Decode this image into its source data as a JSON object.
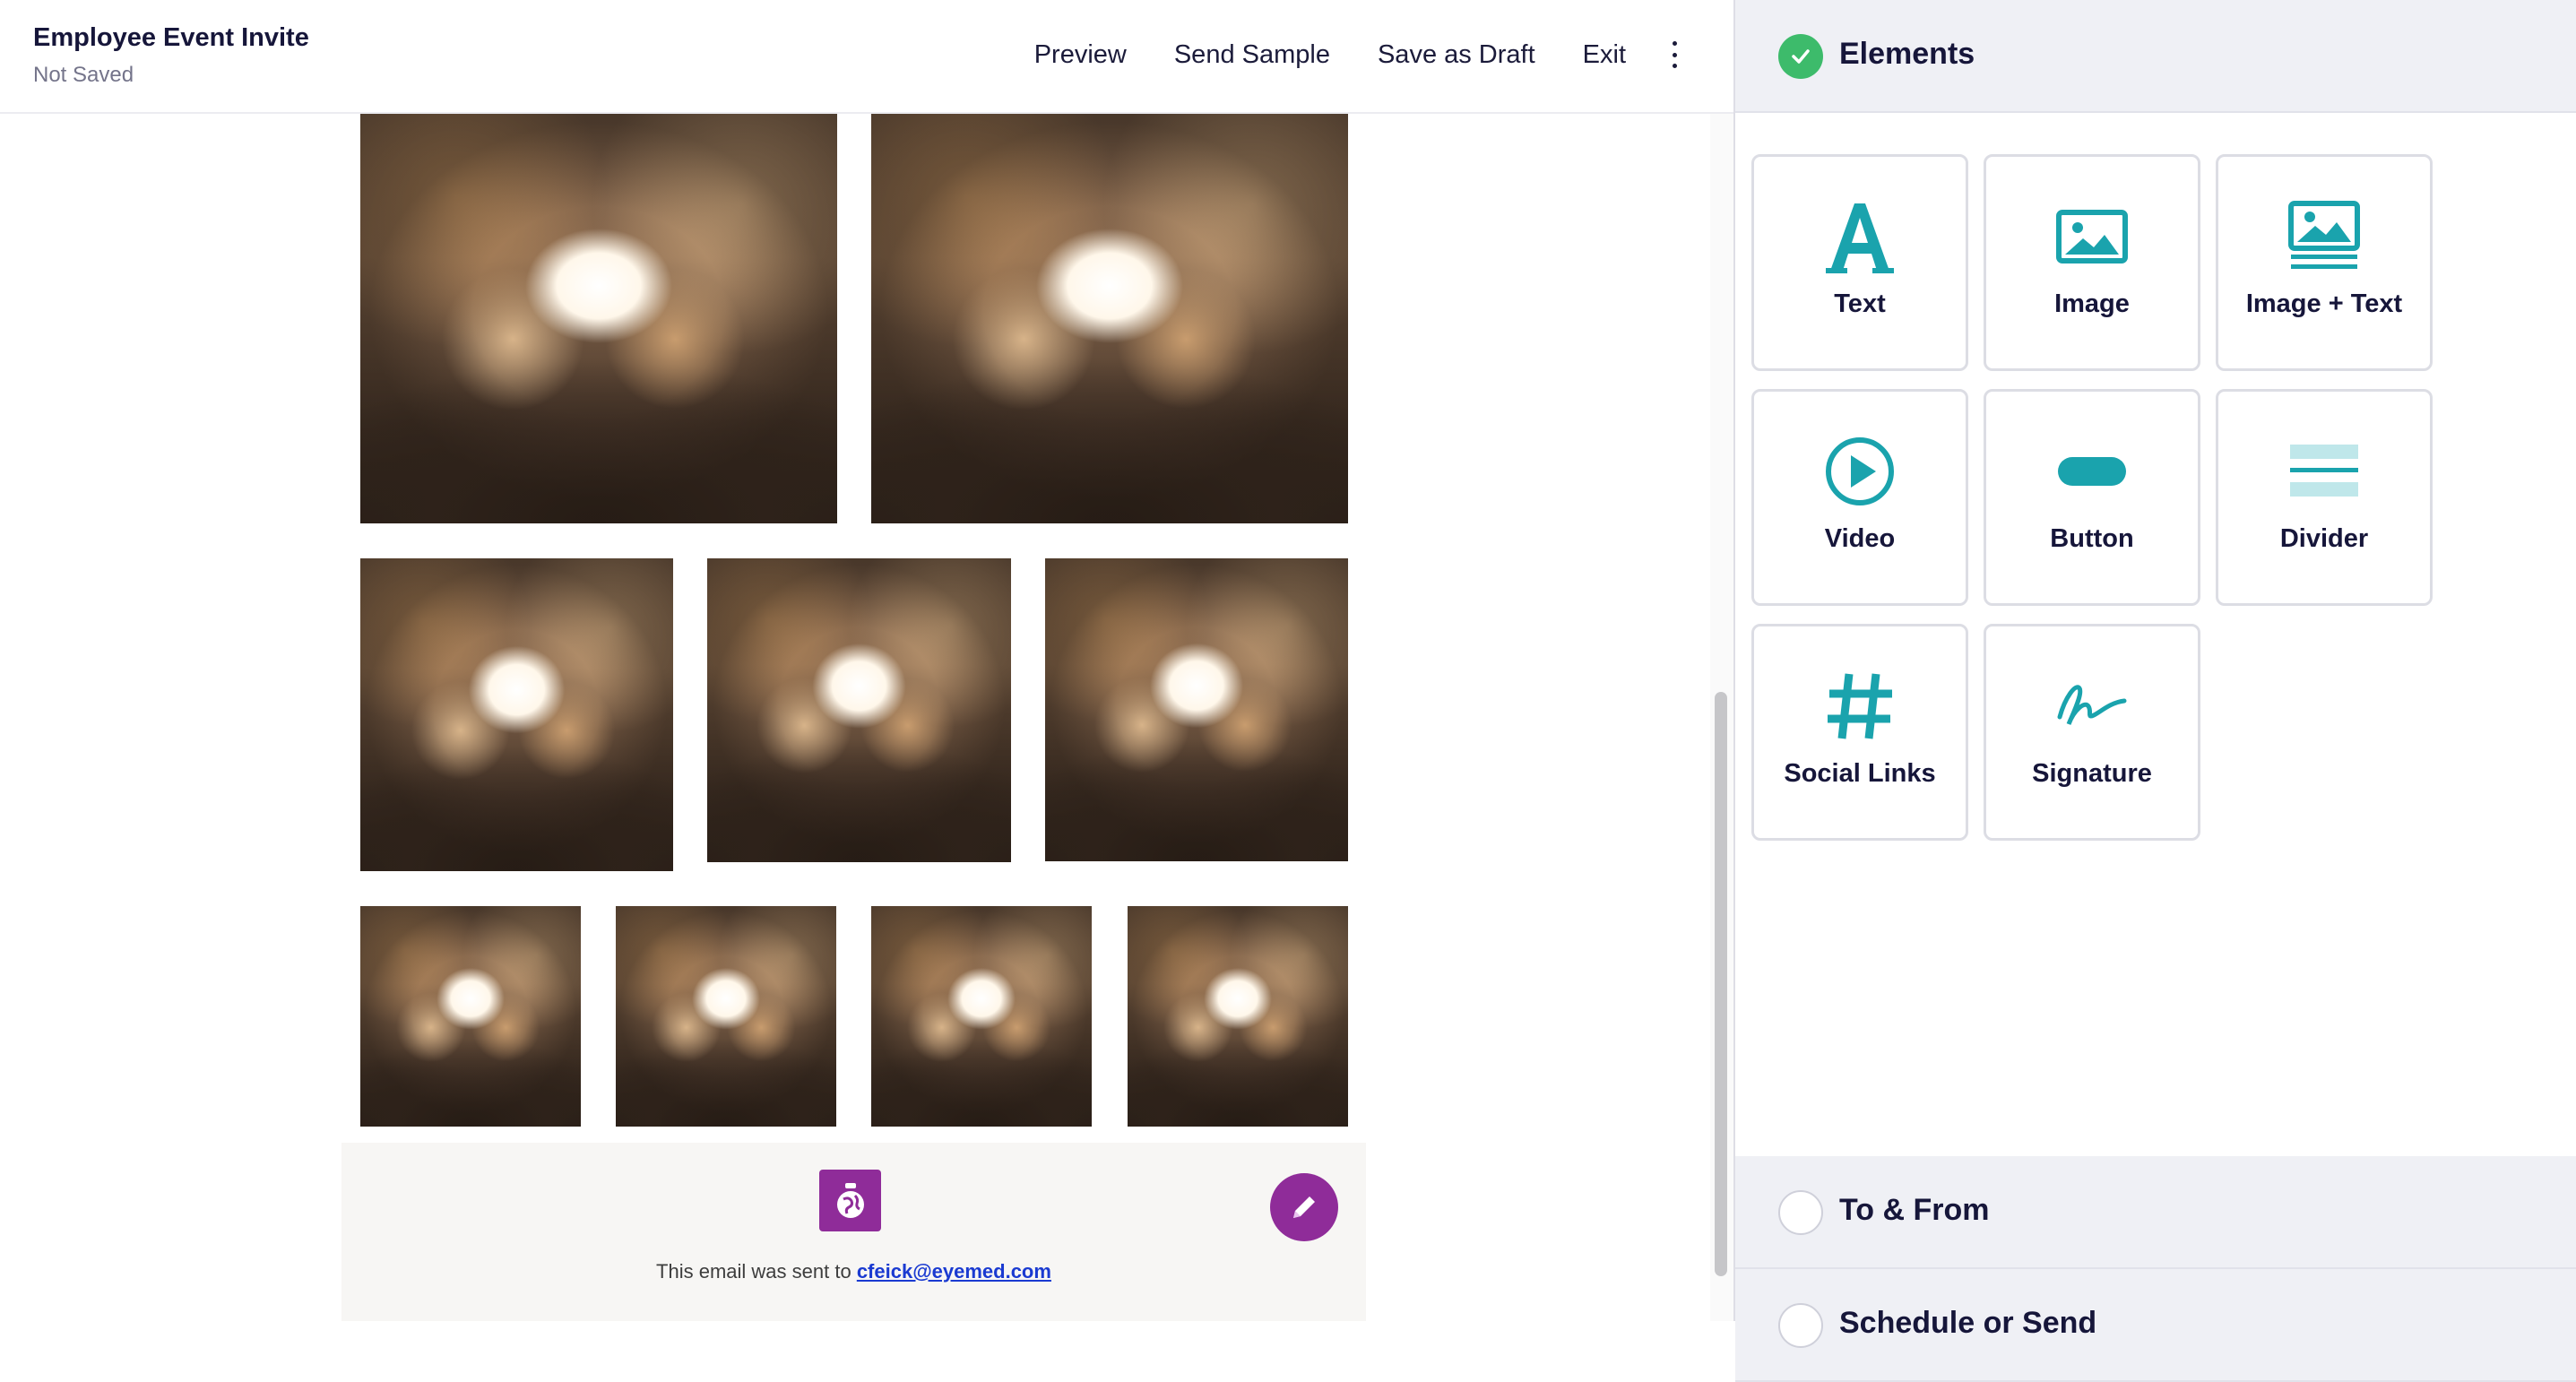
{
  "header": {
    "title": "Employee Event Invite",
    "status": "Not Saved",
    "nav": {
      "preview": "Preview",
      "send_sample": "Send Sample",
      "save_draft": "Save as Draft",
      "exit": "Exit"
    }
  },
  "canvas": {
    "photo_alt": "group-huddle-photo",
    "footer": {
      "sent_prefix": "This email was sent to",
      "sent_email": "cfeick@eyemed.com"
    }
  },
  "panel": {
    "sections": [
      {
        "title": "Elements",
        "state": "complete"
      },
      {
        "title": "To & From",
        "state": "incomplete"
      },
      {
        "title": "Schedule or Send",
        "state": "incomplete"
      }
    ],
    "elements": [
      {
        "label": "Text",
        "icon": "text-icon"
      },
      {
        "label": "Image",
        "icon": "image-icon"
      },
      {
        "label": "Image + Text",
        "icon": "image-text-icon"
      },
      {
        "label": "Video",
        "icon": "video-icon"
      },
      {
        "label": "Button",
        "icon": "button-icon"
      },
      {
        "label": "Divider",
        "icon": "divider-icon"
      },
      {
        "label": "Social Links",
        "icon": "hashtag-icon"
      },
      {
        "label": "Signature",
        "icon": "signature-icon"
      }
    ]
  },
  "colors": {
    "accent_teal": "#1aa3ad",
    "brand_purple": "#8f2c99",
    "success_green": "#3dbb6b",
    "link_blue": "#1a3ad1"
  }
}
